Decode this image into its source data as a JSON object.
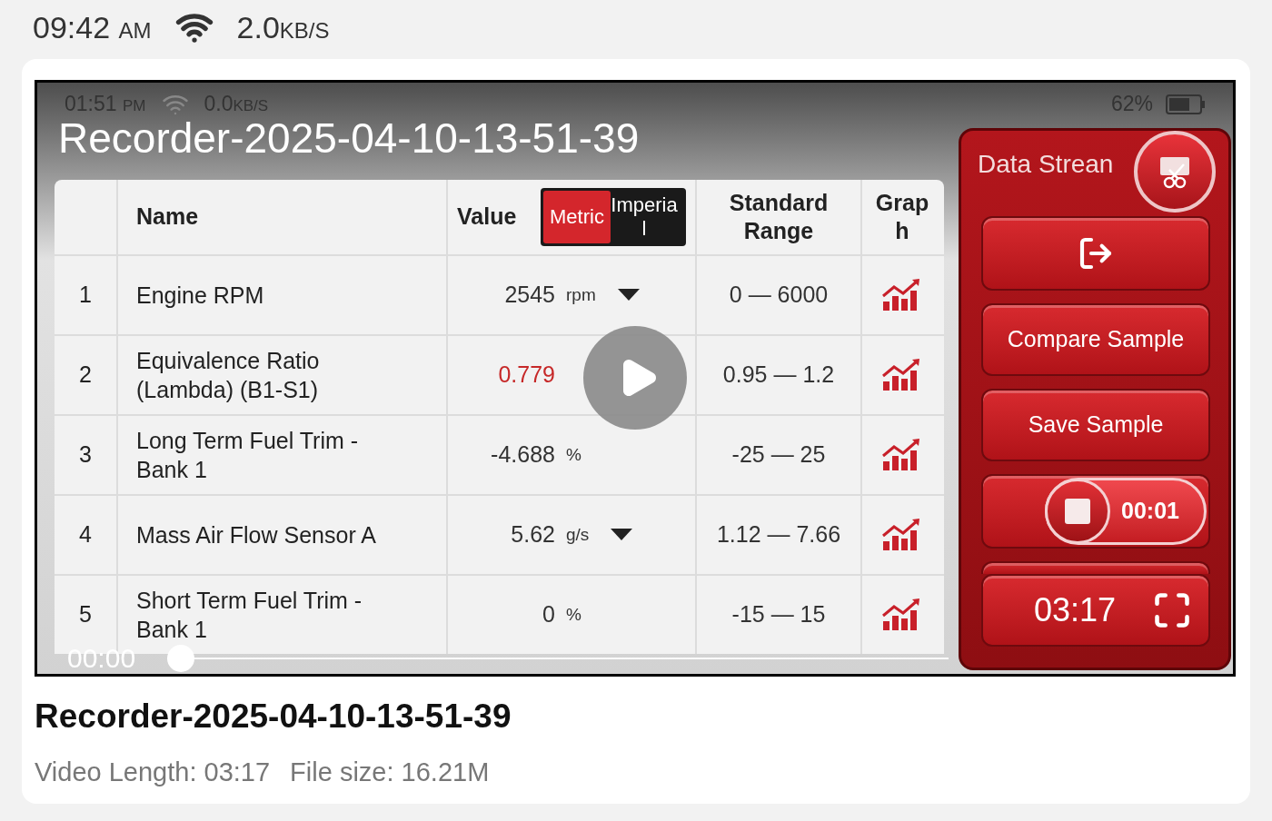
{
  "status_bar": {
    "time": "09:42",
    "ampm": "AM",
    "speed": "2.0",
    "speed_unit": "KB/S"
  },
  "video": {
    "title": "Recorder-2025-04-10-13-51-39",
    "current_time": "00:00",
    "duration": "03:17",
    "progress": {
      "level": 0
    },
    "frame": {
      "status_bar": {
        "time": "01:51",
        "ampm": "PM",
        "speed": "0.0",
        "speed_unit": "KB/S",
        "battery": "62%"
      },
      "table": {
        "columns": [
          "Name",
          "Value",
          "Standard Range",
          "Graph"
        ],
        "units": [
          {
            "label": "Metric",
            "selected": true
          },
          {
            "label": "Imperial",
            "selected": false
          }
        ],
        "rows": [
          {
            "number": "1",
            "name": "Engine RPM",
            "value": "2545",
            "unit": "rpm",
            "dropdown": true,
            "out_of_range": false,
            "range": "0 — 6000"
          },
          {
            "number": "2",
            "name": "Equivalence Ratio (Lambda) (B1-S1)",
            "value": "0.779",
            "unit": "",
            "dropdown": false,
            "out_of_range": true,
            "range": "0.95 — 1.2"
          },
          {
            "number": "3",
            "name": "Long Term Fuel Trim - Bank 1",
            "value": "-4.688",
            "unit": "%",
            "dropdown": false,
            "out_of_range": false,
            "range": "-25 — 25"
          },
          {
            "number": "4",
            "name": "Mass Air Flow Sensor A",
            "value": "5.62",
            "unit": "g/s",
            "dropdown": true,
            "out_of_range": false,
            "range": "1.12 — 7.66"
          },
          {
            "number": "5",
            "name": "Short Term Fuel Trim - Bank 1",
            "value": "0",
            "unit": "%",
            "dropdown": false,
            "out_of_range": false,
            "range": "-15 — 15"
          }
        ]
      },
      "panel": {
        "title": "Data Strean",
        "buttons": [
          "Compare Sample",
          "Save Sample"
        ],
        "record_time": "00:01"
      }
    }
  },
  "file": {
    "title": "Recorder-2025-04-10-13-51-39",
    "length": "Video Length: 03:17",
    "size": "File size: 16.21M"
  }
}
